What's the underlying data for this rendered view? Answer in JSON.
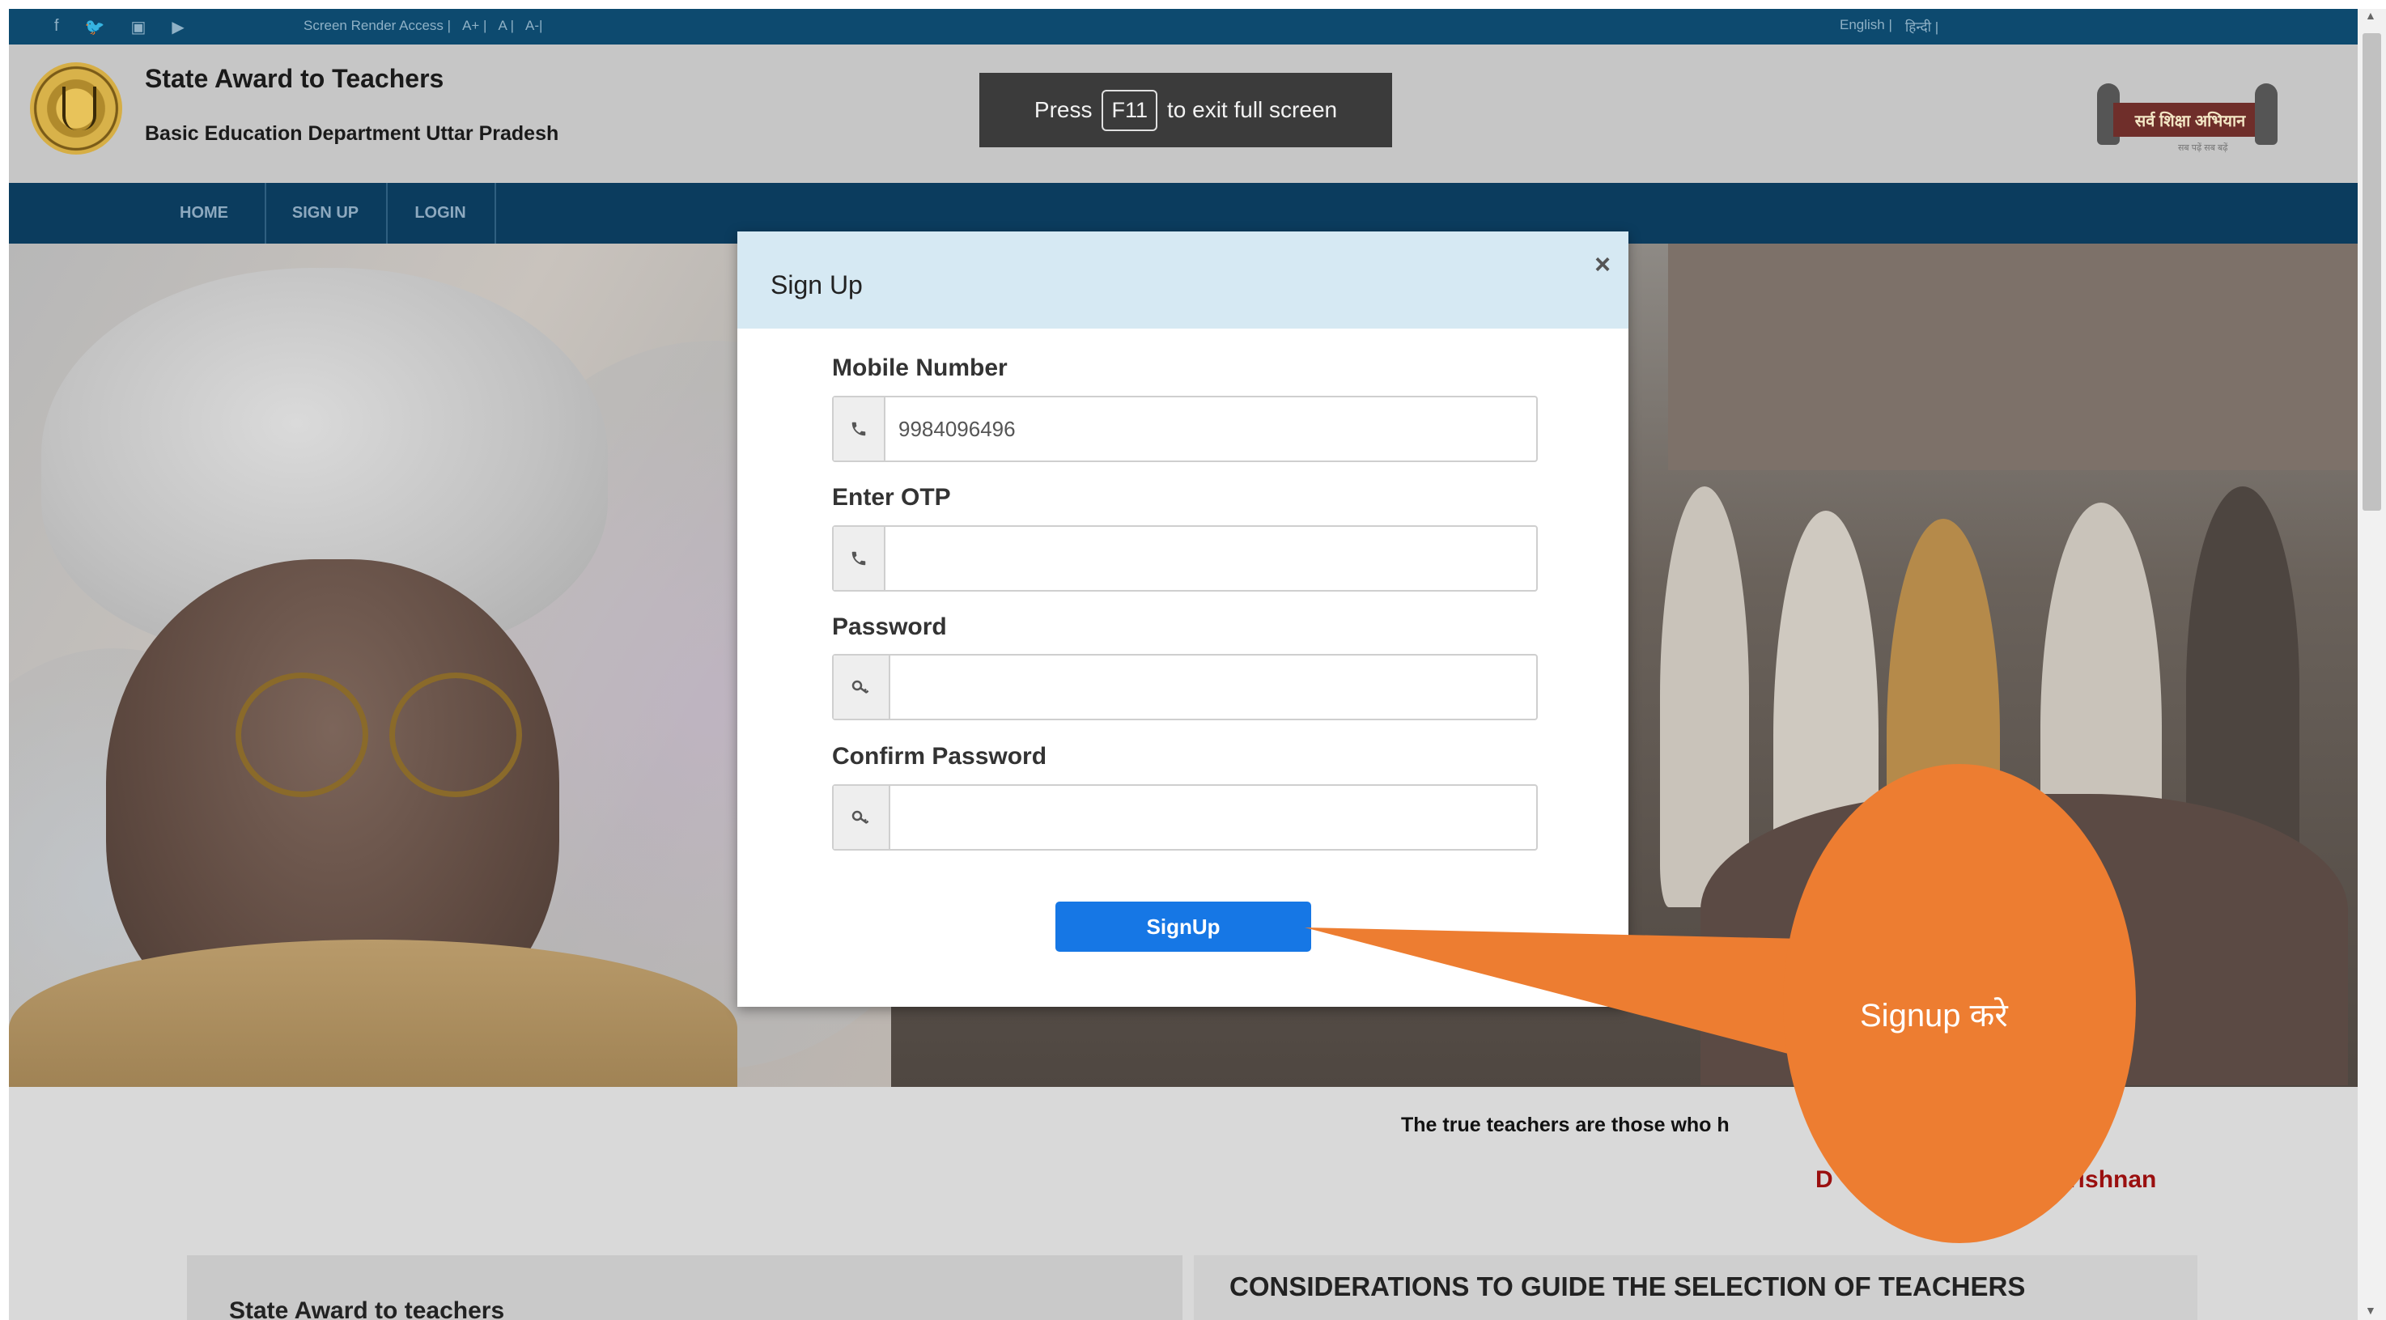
{
  "topbar": {
    "social": [
      "f",
      "🐦",
      "▣",
      "▶"
    ],
    "access": [
      "Screen Render Access |",
      "A+ |",
      "A |",
      "A-|"
    ],
    "lang": [
      "English |",
      "हिन्दी |"
    ]
  },
  "header": {
    "title": "State Award to Teachers",
    "subtitle": "Basic Education Department Uttar Pradesh",
    "ssa_logo_text": "सर्व शिक्षा अभियान",
    "ssa_logo_tag": "सब पढ़ें सब बढ़ें"
  },
  "fullscreen_notice": {
    "press": "Press",
    "key": "F11",
    "rest": "to exit full screen"
  },
  "nav": {
    "items": [
      "HOME",
      "SIGN UP",
      "LOGIN"
    ]
  },
  "modal": {
    "title": "Sign Up",
    "close": "×",
    "mobile_label": "Mobile Number",
    "mobile_value": "9984096496",
    "otp_label": "Enter OTP",
    "otp_value": "",
    "password_label": "Password",
    "password_value": "",
    "confirm_label": "Confirm Password",
    "confirm_value": "",
    "signup_button": "SignUp"
  },
  "callout": {
    "text": "Signup करे",
    "color": "#ed7d31"
  },
  "quote": {
    "text": "The true teachers are those who h",
    "author_start": "D",
    "author_end": "rishnan"
  },
  "sections": {
    "left_title": "State Award to teachers",
    "right_title": "CONSIDERATIONS TO GUIDE THE SELECTION OF TEACHERS"
  },
  "colors": {
    "topbar": "#0d4a6f",
    "nav": "#0b3c5e",
    "modal_header": "#d6e9f3",
    "signup_button": "#1677e5",
    "author": "#9a0f0f"
  }
}
